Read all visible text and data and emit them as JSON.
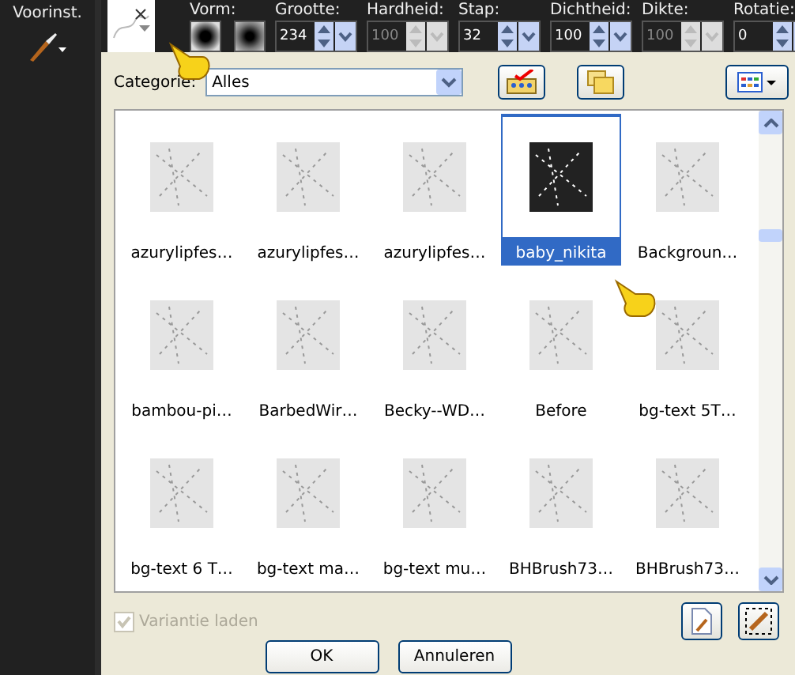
{
  "toolbar": {
    "preset_label": "Voorinst.",
    "shape_label": "Vorm:",
    "fields": [
      {
        "label": "Grootte:",
        "value": "234",
        "disabled": false
      },
      {
        "label": "Hardheid:",
        "value": "100",
        "disabled": true
      },
      {
        "label": "Stap:",
        "value": "32",
        "disabled": false
      },
      {
        "label": "Dichtheid:",
        "value": "100",
        "disabled": false
      },
      {
        "label": "Dikte:",
        "value": "100",
        "disabled": true
      },
      {
        "label": "Rotatie:",
        "value": "0",
        "disabled": false
      }
    ]
  },
  "dialog": {
    "category_label": "Categorie:",
    "category_value": "Alles",
    "brushes": [
      {
        "name": "azurylipfes…",
        "selected": false
      },
      {
        "name": "azurylipfes…",
        "selected": false
      },
      {
        "name": "azurylipfes…",
        "selected": false
      },
      {
        "name": "baby_nikita",
        "selected": true
      },
      {
        "name": "Backgroun…",
        "selected": false
      },
      {
        "name": "bambou-pi…",
        "selected": false
      },
      {
        "name": "BarbedWir…",
        "selected": false
      },
      {
        "name": "Becky--WD…",
        "selected": false
      },
      {
        "name": "Before",
        "selected": false
      },
      {
        "name": "bg-text 5T…",
        "selected": false
      },
      {
        "name": "bg-text 6 T…",
        "selected": false
      },
      {
        "name": "bg-text ma…",
        "selected": false
      },
      {
        "name": "bg-text mu…",
        "selected": false
      },
      {
        "name": "BHBrush73…",
        "selected": false
      },
      {
        "name": "BHBrush73…",
        "selected": false
      }
    ],
    "variant": {
      "label": "Variantie laden",
      "checked": true,
      "disabled": true
    },
    "buttons": [
      "OK",
      "Annuleren"
    ]
  }
}
